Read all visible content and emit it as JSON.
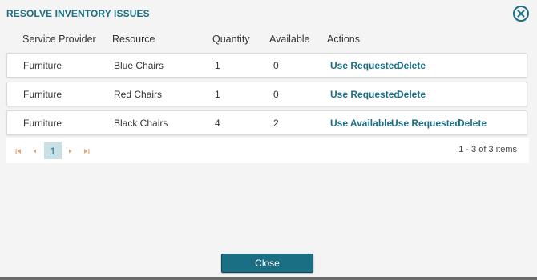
{
  "dialog": {
    "title": "RESOLVE INVENTORY ISSUES",
    "close_button": "Close",
    "close_icon": "circle-x-icon"
  },
  "table": {
    "columns": [
      "Service Provider",
      "Resource",
      "Quantity",
      "Available",
      "Actions"
    ],
    "rows": [
      {
        "provider": "Furniture",
        "resource": "Blue Chairs",
        "quantity": "1",
        "available": "0",
        "actions": [
          "Use Requested",
          "Delete"
        ]
      },
      {
        "provider": "Furniture",
        "resource": "Red Chairs",
        "quantity": "1",
        "available": "0",
        "actions": [
          "Use Requested",
          "Delete"
        ]
      },
      {
        "provider": "Furniture",
        "resource": "Black Chairs",
        "quantity": "4",
        "available": "2",
        "actions": [
          "Use Available",
          "Use Requested",
          "Delete"
        ]
      }
    ]
  },
  "pager": {
    "current_page": "1",
    "info": "1 - 3 of 3 items"
  },
  "colors": {
    "accent": "#1b6f84",
    "pager_arrow": "#e8a87c"
  }
}
